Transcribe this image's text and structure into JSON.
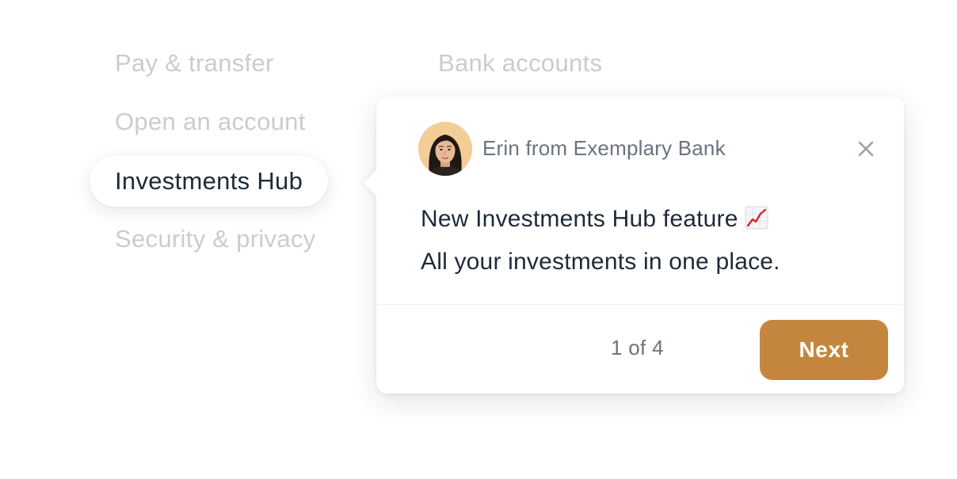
{
  "nav": {
    "items": [
      {
        "label": "Pay & transfer",
        "active": false
      },
      {
        "label": "Open an account",
        "active": false
      },
      {
        "label": "Investments Hub",
        "active": true
      },
      {
        "label": "Security & privacy",
        "active": false
      }
    ],
    "secondary": {
      "label": "Bank accounts"
    }
  },
  "popover": {
    "sender": "Erin from Exemplary Bank",
    "avatar_icon": "avatar-photo",
    "close_icon": "close-icon",
    "message_line1": "New Investments Hub feature",
    "message_emoji": "chart-increasing-icon",
    "message_line2": "All your investments in one place.",
    "step": "1 of 4",
    "next_label": "Next"
  },
  "colors": {
    "accent": "#c4863f",
    "muted_text": "#c9ccd1",
    "primary_text": "#1f2a37",
    "secondary_text": "#6b7380"
  }
}
